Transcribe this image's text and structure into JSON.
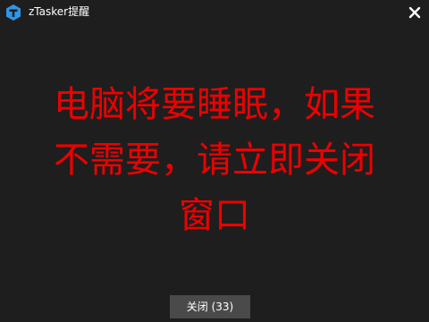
{
  "window": {
    "title": "zTasker提醒"
  },
  "icons": {
    "app": "ztasker-logo-icon",
    "close": "close-icon"
  },
  "message": {
    "lines": [
      "电脑将要睡眠，如果",
      "不需要，请立即关闭",
      "窗口"
    ],
    "color": "#ee0000"
  },
  "buttons": {
    "dismiss_label": "关闭 (33)"
  },
  "colors": {
    "background": "#1e1e1e",
    "button": "#4a4a4a",
    "accent": "#2f95e6"
  }
}
